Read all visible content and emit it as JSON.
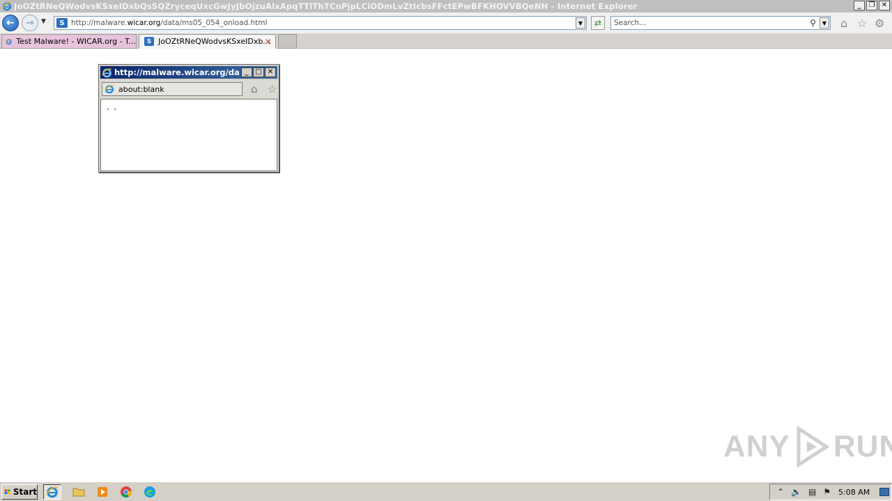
{
  "window": {
    "title": "JoOZtRNeQWodvsKSxeIDxbQsSQZryceqUxcGwJyJbOjzuAlxApqTTlThTCnPjpLCiODmLvZtIcbsFFctEPwBFKHOVVBQeNH - Internet Explorer",
    "minimize": "_",
    "restore": "❐",
    "close": "✕"
  },
  "nav": {
    "address_prefix": "http://malware.",
    "address_domain": "wicar.org",
    "address_suffix": "/data/ms05_054_onload.html",
    "search_placeholder": "Search..."
  },
  "tabs": [
    {
      "label": "Test Malware! - WICAR.org - T..."
    },
    {
      "label": "JoOZtRNeQWodvsKSxeIDxb..."
    }
  ],
  "popup": {
    "title": "http://malware.wicar.org/dat...",
    "address": "about:blank",
    "content_text": "\" \""
  },
  "watermark": {
    "left": "ANY",
    "right": "RUN"
  },
  "taskbar": {
    "start_label": "Start",
    "clock": "5:08 AM"
  },
  "colors": {
    "titlebar_bg": "#bfbfbf",
    "popup_title_bg": "#0a246a",
    "tab_inactive_bg": "#e8c4dc",
    "taskbar_bg": "#d4d0c8"
  }
}
